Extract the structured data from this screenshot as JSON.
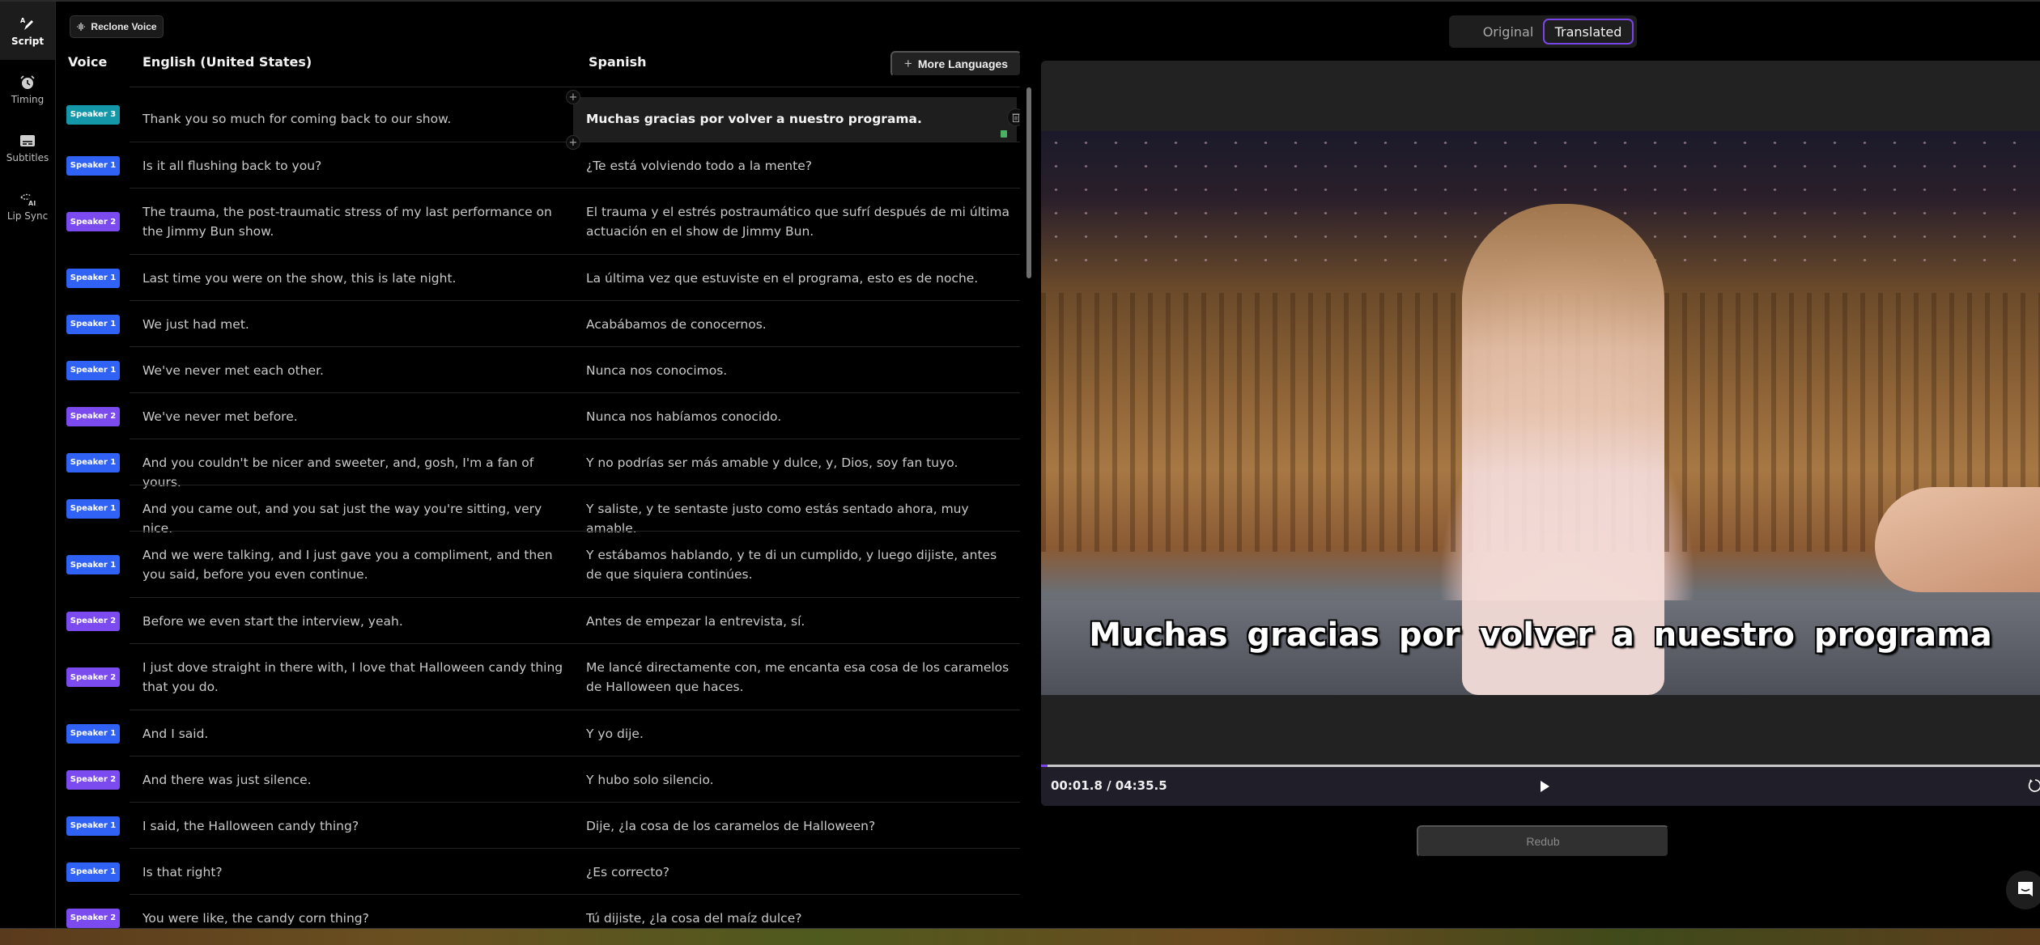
{
  "sidebar": {
    "items": [
      {
        "label": "Script",
        "icon": "script-pen-icon",
        "active": true
      },
      {
        "label": "Timing",
        "icon": "alarm-clock-icon",
        "active": false
      },
      {
        "label": "Subtitles",
        "icon": "subtitles-icon",
        "active": false
      },
      {
        "label": "Lip Sync",
        "icon": "lip-sync-ai-icon",
        "active": false
      }
    ]
  },
  "toolbar": {
    "reclone_voice_label": "Reclone Voice",
    "more_languages_label": "More Languages"
  },
  "table": {
    "headers": {
      "voice": "Voice",
      "source": "English (United States)",
      "target": "Spanish"
    },
    "speaker_colors": {
      "Speaker 1": "#2f62f5",
      "Speaker 2": "#7b4bf0",
      "Speaker 3": "#1497a8"
    },
    "rows": [
      {
        "speaker": "Speaker 3",
        "en": "Thank you so much for coming back to our show.",
        "es": "Muchas gracias por volver a nuestro programa.",
        "active": true
      },
      {
        "speaker": "Speaker 1",
        "en": "Is it all flushing back to you?",
        "es": "¿Te está volviendo todo a la mente?"
      },
      {
        "speaker": "Speaker 2",
        "en": "The trauma, the post-traumatic stress of my last performance on the Jimmy Bun show.",
        "es": "El trauma y el estrés postraumático que sufrí después de mi última actuación en el show de Jimmy Bun."
      },
      {
        "speaker": "Speaker 1",
        "en": "Last time you were on the show, this is late night.",
        "es": "La última vez que estuviste en el programa, esto es de noche."
      },
      {
        "speaker": "Speaker 1",
        "en": "We just had met.",
        "es": "Acabábamos de conocernos."
      },
      {
        "speaker": "Speaker 1",
        "en": "We've never met each other.",
        "es": "Nunca nos conocimos."
      },
      {
        "speaker": "Speaker 2",
        "en": "We've never met before.",
        "es": "Nunca nos habíamos conocido."
      },
      {
        "speaker": "Speaker 1",
        "en": "And you couldn't be nicer and sweeter, and, gosh, I'm a fan of yours.",
        "es": "Y no podrías ser más amable y dulce, y, Dios, soy fan tuyo."
      },
      {
        "speaker": "Speaker 1",
        "en": "And you came out, and you sat just the way you're sitting, very nice.",
        "es": "Y saliste, y te sentaste justo como estás sentado ahora, muy amable."
      },
      {
        "speaker": "Speaker 1",
        "en": "And we were talking, and I just gave you a compliment, and then you said, before you even continue.",
        "es": "Y estábamos hablando, y te di un cumplido, y luego dijiste, antes de que siquiera continúes."
      },
      {
        "speaker": "Speaker 2",
        "en": "Before we even start the interview, yeah.",
        "es": "Antes de empezar la entrevista, sí."
      },
      {
        "speaker": "Speaker 2",
        "en": "I just dove straight in there with, I love that Halloween candy thing that you do.",
        "es": "Me lancé directamente con, me encanta esa cosa de los caramelos de Halloween que haces."
      },
      {
        "speaker": "Speaker 1",
        "en": "And I said.",
        "es": "Y yo dije."
      },
      {
        "speaker": "Speaker 2",
        "en": "And there was just silence.",
        "es": "Y hubo solo silencio."
      },
      {
        "speaker": "Speaker 1",
        "en": "I said, the Halloween candy thing?",
        "es": "Dije, ¿la cosa de los caramelos de Halloween?"
      },
      {
        "speaker": "Speaker 1",
        "en": "Is that right?",
        "es": "¿Es correcto?"
      },
      {
        "speaker": "Speaker 2",
        "en": "You were like, the candy corn thing?",
        "es": "Tú dijiste, ¿la cosa del maíz dulce?"
      }
    ]
  },
  "preview": {
    "toggle": {
      "options": [
        "Original",
        "Translated"
      ],
      "selected": "Translated"
    },
    "subtitle": "Muchas gracias por volver a nuestro programa",
    "timecode": "00:01.8 / 04:35.5",
    "progress_percent": 0.65,
    "accent_color": "#7a45e8"
  },
  "actions": {
    "redub_label": "Redub"
  }
}
